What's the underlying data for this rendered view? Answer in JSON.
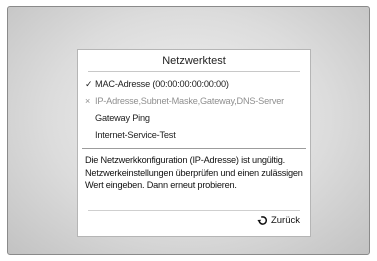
{
  "dialog": {
    "title": "Netzwerktest",
    "checks": [
      {
        "mark": "✓",
        "label": "MAC-Adresse (00:00:00:00:00:00)",
        "status": "passed"
      },
      {
        "mark": "×",
        "label": "IP-Adresse,Subnet-Maske,Gateway,DNS-Server",
        "status": "failed"
      },
      {
        "mark": "",
        "label": "Gateway Ping",
        "status": "pending"
      },
      {
        "mark": "",
        "label": "Internet-Service-Test",
        "status": "pending"
      }
    ],
    "message": "Die Netzwerkkonfiguration (IP-Adresse) ist ungültig. Netzwerkeinstellungen überprüfen und einen zulässigen Wert eingeben. Dann erneut probieren.",
    "back_label": "Zurück",
    "back_icon": "return-arrow-icon"
  }
}
